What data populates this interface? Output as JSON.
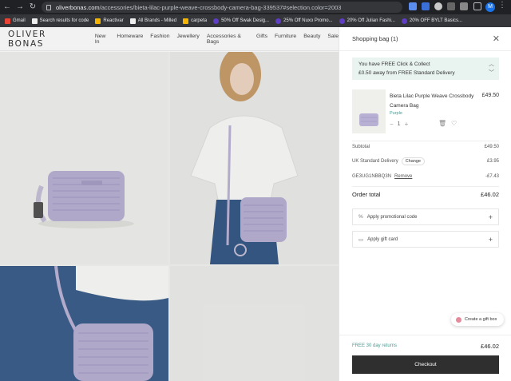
{
  "browser": {
    "url_domain": "oliverbonas.com",
    "url_path": "/accessories/bieta-lilac-purple-weave-crossbody-camera-bag-339537#selection.color=2003",
    "avatar_letter": "M",
    "bookmarks": [
      {
        "label": "Gmail",
        "color": "#ea4335"
      },
      {
        "label": "Search results for code",
        "color": "#333"
      },
      {
        "label": "Reactivar",
        "color": "#f4b400"
      },
      {
        "label": "All Brands - Milled",
        "color": "#333"
      },
      {
        "label": "carpeta",
        "color": "#f4b400"
      },
      {
        "label": "50% Off Swak Desig...",
        "color": "#5f3dc4"
      },
      {
        "label": "25% Off Nuxo Promo...",
        "color": "#5f3dc4"
      },
      {
        "label": "20% Off Julian Fashi...",
        "color": "#5f3dc4"
      },
      {
        "label": "20% OFF BYLT Basics...",
        "color": "#5f3dc4"
      }
    ]
  },
  "site": {
    "logo": "OLIVER BONAS",
    "nav": [
      "New In",
      "Homeware",
      "Fashion",
      "Jewellery",
      "Accessories & Bags",
      "Gifts",
      "Furniture",
      "Beauty",
      "Sale"
    ]
  },
  "drawer": {
    "title": "Shopping bag (1)",
    "promo_line1": "You have FREE Click & Collect",
    "promo_line2": "£0.50 away from FREE Standard Delivery",
    "item": {
      "name": "Bieta Lilac Purple Weave Crossbody Camera Bag",
      "color": "Purple",
      "price": "£49.50",
      "quantity": "1"
    },
    "subtotal_label": "Subtotal",
    "subtotal_value": "£49.50",
    "delivery_label": "UK Standard Delivery",
    "change_label": "Change",
    "delivery_value": "£3.95",
    "code_label": "GE3UG1NBBQ3N",
    "remove_label": "Remove",
    "code_value": "-£7.43",
    "order_total_label": "Order total",
    "order_total_value": "£46.02",
    "promo_code_label": "Apply promotional code",
    "gift_card_label": "Apply gift card",
    "gift_box_label": "Create a gift box",
    "returns_label": "FREE 30 day returns",
    "footer_total": "£46.02",
    "checkout_label": "Checkout"
  },
  "colors": {
    "accent_teal": "#4a9b93",
    "promo_bg": "#e9f3f0",
    "checkout_bg": "#2f2f2f",
    "bag_lilac": "#b9b1d4"
  }
}
